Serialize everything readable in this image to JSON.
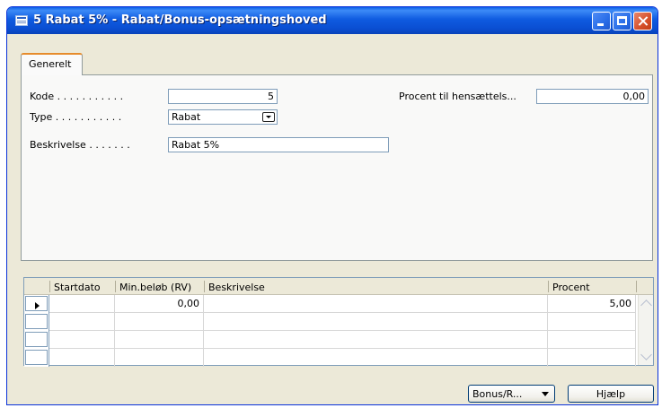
{
  "window": {
    "title": "5 Rabat 5% - Rabat/Bonus-opsætningshoved"
  },
  "tabs": [
    {
      "label": "Generelt",
      "selected": true
    }
  ],
  "form": {
    "kode_label": "Kode . . . . . . . . . . .",
    "kode_value": "5",
    "type_label": "Type . . . . . . . . . . .",
    "type_value": "Rabat",
    "beskrivelse_label": "Beskrivelse . . . . . . .",
    "beskrivelse_value": "Rabat 5%",
    "procent_label": "Procent til hensættels...",
    "procent_value": "0,00"
  },
  "lines": {
    "columns": [
      "Startdato",
      "Min.beløb (RV)",
      "Beskrivelse",
      "Procent"
    ],
    "rows": [
      {
        "startdato": "",
        "min_beloeb": "0,00",
        "beskrivelse": "",
        "procent": "5,00"
      },
      {
        "startdato": "",
        "min_beloeb": "",
        "beskrivelse": "",
        "procent": ""
      },
      {
        "startdato": "",
        "min_beloeb": "",
        "beskrivelse": "",
        "procent": ""
      },
      {
        "startdato": "",
        "min_beloeb": "",
        "beskrivelse": "",
        "procent": ""
      }
    ]
  },
  "buttons": {
    "bonus_label": "Bonus/R...",
    "help_label": "Hjælp"
  },
  "icons": {
    "window": "form-icon",
    "minimize": "minimize-icon",
    "maximize": "maximize-icon",
    "close": "close-icon",
    "row_marker": "current-row-icon"
  },
  "colors": {
    "titlebar": "#0A4ED2",
    "window_bg": "#ECE9D8",
    "tab_accent": "#E68B2C",
    "close_button": "#D6502A"
  }
}
